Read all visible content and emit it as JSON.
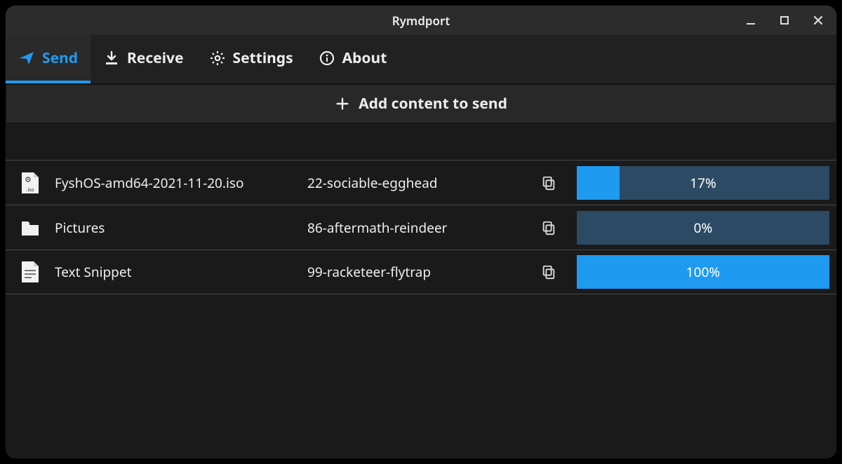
{
  "window": {
    "title": "Rymdport"
  },
  "tabs": [
    {
      "label": "Send",
      "icon": "paper-plane-icon",
      "active": true
    },
    {
      "label": "Receive",
      "icon": "download-icon",
      "active": false
    },
    {
      "label": "Settings",
      "icon": "gear-icon",
      "active": false
    },
    {
      "label": "About",
      "icon": "info-icon",
      "active": false
    }
  ],
  "add_button": {
    "label": "Add content to send"
  },
  "transfers": [
    {
      "icon": "iso-file-icon",
      "name": "FyshOS-amd64-2021-11-20.iso",
      "code": "22-sociable-egghead",
      "progress_percent": 17,
      "progress_label": "17%"
    },
    {
      "icon": "folder-icon",
      "name": "Pictures",
      "code": "86-aftermath-reindeer",
      "progress_percent": 0,
      "progress_label": "0%"
    },
    {
      "icon": "text-file-icon",
      "name": "Text Snippet",
      "code": "99-racketeer-flytrap",
      "progress_percent": 100,
      "progress_label": "100%"
    }
  ],
  "colors": {
    "accent": "#1e9bf0",
    "progress_track": "#2c4a63"
  }
}
